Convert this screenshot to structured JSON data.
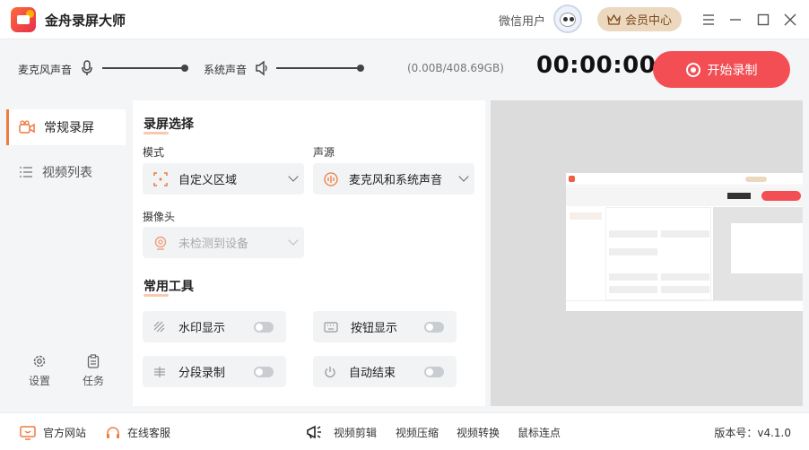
{
  "app": {
    "title": "金舟录屏大师"
  },
  "header": {
    "user_name": "微信用户",
    "vip_label": "会员中心",
    "window_controls": [
      "menu-icon",
      "minimize-icon",
      "maximize-icon",
      "close-icon"
    ]
  },
  "audio": {
    "mic_label": "麦克风声音",
    "system_label": "系统声音",
    "mic_level": 1.0,
    "system_level": 1.0
  },
  "status": {
    "storage": "(0.00B/408.69GB)",
    "timer": "00:00:00"
  },
  "record_button": {
    "label": "开始录制"
  },
  "sidebar": {
    "items": [
      {
        "label": "常规录屏",
        "icon": "camera-icon",
        "active": true
      },
      {
        "label": "视频列表",
        "icon": "list-icon",
        "active": false
      }
    ],
    "bottom": [
      {
        "label": "设置",
        "icon": "gear-icon"
      },
      {
        "label": "任务",
        "icon": "clipboard-icon"
      }
    ]
  },
  "screen_select": {
    "title": "录屏选择",
    "mode_label": "模式",
    "mode_value": "自定义区域",
    "audio_label": "声源",
    "audio_value": "麦克风和系统声音",
    "camera_label": "摄像头",
    "camera_value": "未检测到设备"
  },
  "tools": {
    "title": "常用工具",
    "items": [
      {
        "label": "水印显示",
        "icon": "watermark-icon",
        "on": false
      },
      {
        "label": "按钮显示",
        "icon": "keyboard-icon",
        "on": false
      },
      {
        "label": "分段录制",
        "icon": "segment-icon",
        "on": false
      },
      {
        "label": "自动结束",
        "icon": "power-icon",
        "on": false
      }
    ]
  },
  "footer": {
    "website": "官方网站",
    "support": "在线客服",
    "links": [
      "视频剪辑",
      "视频压缩",
      "视频转换",
      "鼠标连点"
    ],
    "version": "版本号：v4.1.0"
  },
  "colors": {
    "accent": "#f24e54",
    "vip_bg": "#ecd8bf",
    "active_bar": "#f07b3f"
  }
}
